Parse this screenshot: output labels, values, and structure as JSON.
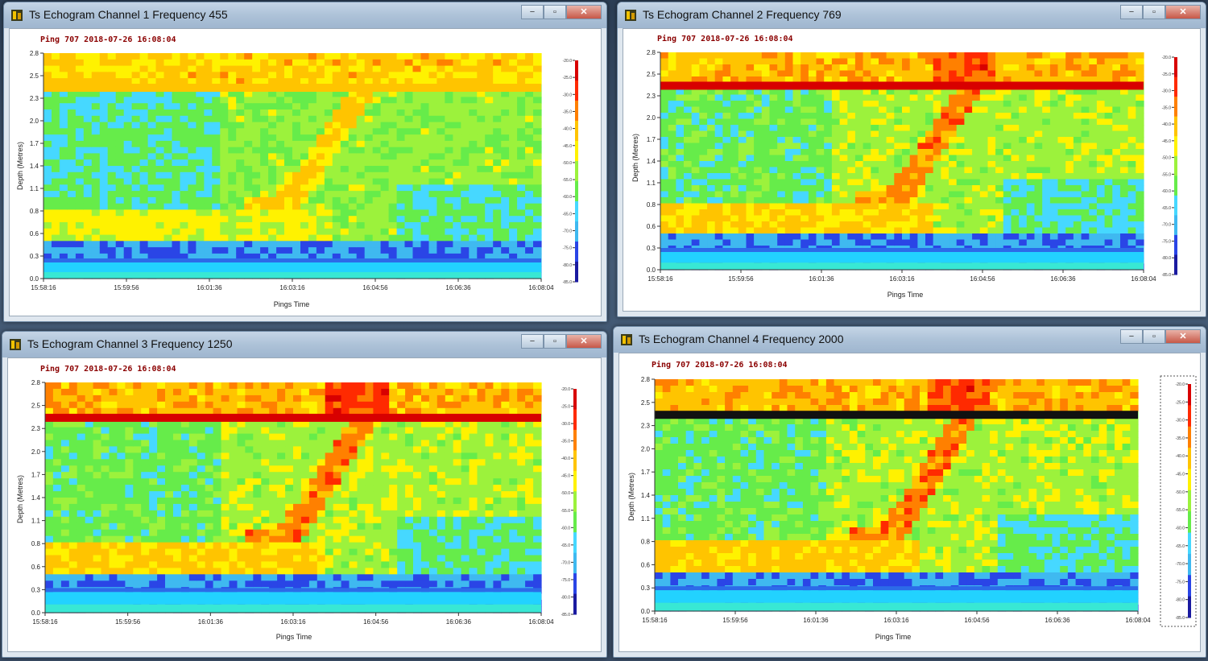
{
  "colors": {
    "colormap": [
      "#1a1aa0",
      "#2a45e6",
      "#3fb9f0",
      "#46d8ff",
      "#66ec4a",
      "#9cf23c",
      "#fff200",
      "#ffc400",
      "#ff8000",
      "#ff2a00",
      "#d80000"
    ],
    "bottom_band": [
      "#2c6be8",
      "#22d2ff",
      "#38e8d4"
    ],
    "ping_text": "#8b0000"
  },
  "windows": [
    {
      "title": "Ts Echogram Channel 1 Frequency 455",
      "ping_label": "Ping 707 2018-07-26 16:08:04",
      "ylabel": "Depth (Metres)",
      "xlabel": "Pings Time",
      "yticks": [
        "0.0",
        "0.3",
        "0.6",
        "0.8",
        "1.1",
        "1.4",
        "1.7",
        "2.0",
        "2.3",
        "2.5",
        "2.8"
      ],
      "xticks": [
        "15:58:16",
        "15:59:56",
        "16:01:36",
        "16:03:16",
        "16:04:56",
        "16:06:36",
        "16:08:04"
      ],
      "scale_ticks": [
        "-20.0",
        "-25.0",
        "-30.0",
        "-35.0",
        "-40.0",
        "-45.0",
        "-50.0",
        "-55.0",
        "-60.0",
        "-65.0",
        "-70.0",
        "-75.0",
        "-80.0",
        "-85.0"
      ],
      "echogram": {
        "surface_line_depth": 2.37,
        "surface_level": 6.6,
        "fish_start_x": 0.58,
        "seabed_depth": 0.25,
        "intensity_offset": -1.3
      }
    },
    {
      "title": "Ts Echogram Channel 2 Frequency 769",
      "ping_label": "Ping 707 2018-07-26 16:08:04",
      "ylabel": "Depth (Metres)",
      "xlabel": "Pings Time",
      "yticks": [
        "0.0",
        "0.3",
        "0.6",
        "0.8",
        "1.1",
        "1.4",
        "1.7",
        "2.0",
        "2.3",
        "2.5",
        "2.8"
      ],
      "xticks": [
        "15:58:16",
        "15:59:56",
        "16:01:36",
        "16:03:16",
        "16:04:56",
        "16:06:36",
        "16:08:04"
      ],
      "scale_ticks": [
        "-20.0",
        "-25.0",
        "-30.0",
        "-35.0",
        "-40.0",
        "-45.0",
        "-50.0",
        "-55.0",
        "-60.0",
        "-65.0",
        "-70.0",
        "-75.0",
        "-80.0",
        "-85.0"
      ],
      "echogram": {
        "surface_line_depth": 2.37,
        "surface_level": 9.6,
        "fish_start_x": 0.55,
        "seabed_depth": 0.28,
        "intensity_offset": 0
      }
    },
    {
      "title": "Ts Echogram Channel 3 Frequency 1250",
      "ping_label": "Ping 707 2018-07-26 16:08:04",
      "ylabel": "Depth (Metres)",
      "xlabel": "Pings Time",
      "yticks": [
        "0.0",
        "0.3",
        "0.6",
        "0.8",
        "1.1",
        "1.4",
        "1.7",
        "2.0",
        "2.3",
        "2.5",
        "2.8"
      ],
      "xticks": [
        "15:58:16",
        "15:59:56",
        "16:01:36",
        "16:03:16",
        "16:04:56",
        "16:06:36",
        "16:08:04"
      ],
      "scale_ticks": [
        "-20.0",
        "-25.0",
        "-30.0",
        "-35.0",
        "-40.0",
        "-45.0",
        "-50.0",
        "-55.0",
        "-60.0",
        "-65.0",
        "-70.0",
        "-75.0",
        "-80.0",
        "-85.0"
      ],
      "echogram": {
        "surface_line_depth": 2.37,
        "surface_level": 10,
        "fish_start_x": 0.55,
        "seabed_depth": 0.3,
        "intensity_offset": 0.2
      }
    },
    {
      "title": "Ts Echogram Channel 4 Frequency 2000",
      "ping_label": "Ping 707 2018-07-26 16:08:04",
      "ylabel": "Depth (Metres)",
      "xlabel": "Pings Time",
      "yticks": [
        "0.0",
        "0.3",
        "0.6",
        "0.8",
        "1.1",
        "1.4",
        "1.7",
        "2.0",
        "2.3",
        "2.5",
        "2.8"
      ],
      "xticks": [
        "15:58:16",
        "15:59:56",
        "16:01:36",
        "16:03:16",
        "16:04:56",
        "16:06:36",
        "16:08:04"
      ],
      "scale_ticks": [
        "-20.0",
        "-25.0",
        "-30.0",
        "-35.0",
        "-40.0",
        "-45.0",
        "-50.0",
        "-55.0",
        "-60.0",
        "-65.0",
        "-70.0",
        "-75.0",
        "-80.0",
        "-85.0"
      ],
      "echogram": {
        "surface_line_depth": 2.37,
        "surface_level": 11,
        "fish_start_x": 0.54,
        "seabed_depth": 0.3,
        "intensity_offset": 0.2
      }
    }
  ],
  "window_controls": {
    "minimize": "−",
    "maximize": "▫",
    "close": "✕"
  }
}
